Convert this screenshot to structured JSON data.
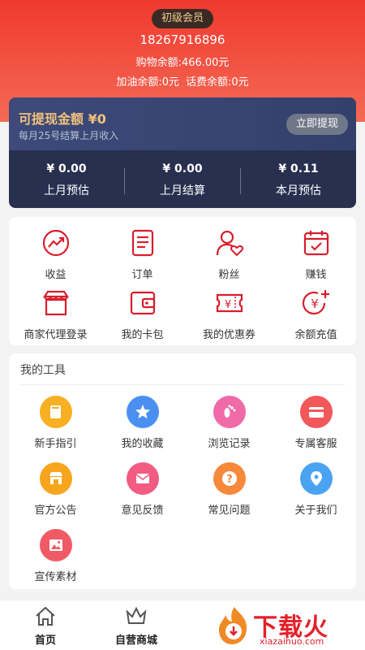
{
  "header": {
    "member_level": "初级会员",
    "phone": "18267916896",
    "shopping_balance": "购物余额:466.00元",
    "fuel_balance": "加油余额:0元",
    "phone_bill_balance": "话费余额:0元"
  },
  "withdraw": {
    "title": "可提现金额 ¥0",
    "subtitle": "每月25号结算上月收入",
    "button": "立即提现",
    "stats": [
      {
        "amount": "¥ 0.00",
        "label": "上月预估"
      },
      {
        "amount": "¥ 0.00",
        "label": "上月结算"
      },
      {
        "amount": "¥ 0.11",
        "label": "本月预估"
      }
    ]
  },
  "menu": {
    "items": [
      {
        "label": "收益",
        "icon": "trend-icon"
      },
      {
        "label": "订单",
        "icon": "order-icon"
      },
      {
        "label": "粉丝",
        "icon": "fans-icon"
      },
      {
        "label": "赚钱",
        "icon": "calendar-check-icon"
      },
      {
        "label": "商家代理登录",
        "icon": "store-icon"
      },
      {
        "label": "我的卡包",
        "icon": "wallet-icon"
      },
      {
        "label": "我的优惠券",
        "icon": "coupon-icon"
      },
      {
        "label": "余额充值",
        "icon": "yen-plus-icon"
      }
    ]
  },
  "tools": {
    "title": "我的工具",
    "items": [
      {
        "label": "新手指引",
        "icon": "guide-icon",
        "color": "#f7b021"
      },
      {
        "label": "我的收藏",
        "icon": "star-icon",
        "color": "#4a90f0"
      },
      {
        "label": "浏览记录",
        "icon": "footprint-icon",
        "color": "#f06aa8"
      },
      {
        "label": "专属客服",
        "icon": "card-icon",
        "color": "#f2575a"
      },
      {
        "label": "官方公告",
        "icon": "shop-notice-icon",
        "color": "#f7a51e"
      },
      {
        "label": "意见反馈",
        "icon": "mail-icon",
        "color": "#f25b82"
      },
      {
        "label": "常见问题",
        "icon": "question-icon",
        "color": "#f7893a"
      },
      {
        "label": "关于我们",
        "icon": "location-icon",
        "color": "#4aa3f0"
      },
      {
        "label": "宣传素材",
        "icon": "image-icon",
        "color": "#f05a64"
      }
    ]
  },
  "tabbar": {
    "items": [
      {
        "label": "首页",
        "icon": "home-icon"
      },
      {
        "label": "自营商城",
        "icon": "crown-icon"
      }
    ]
  },
  "watermark": {
    "text": "下载火",
    "url": "xiazaihuo.com"
  },
  "colors": {
    "accent": "#e3202a",
    "header_gradient_start": "#f0392e",
    "card_navy": "#27304f",
    "gold": "#f2c27c"
  }
}
